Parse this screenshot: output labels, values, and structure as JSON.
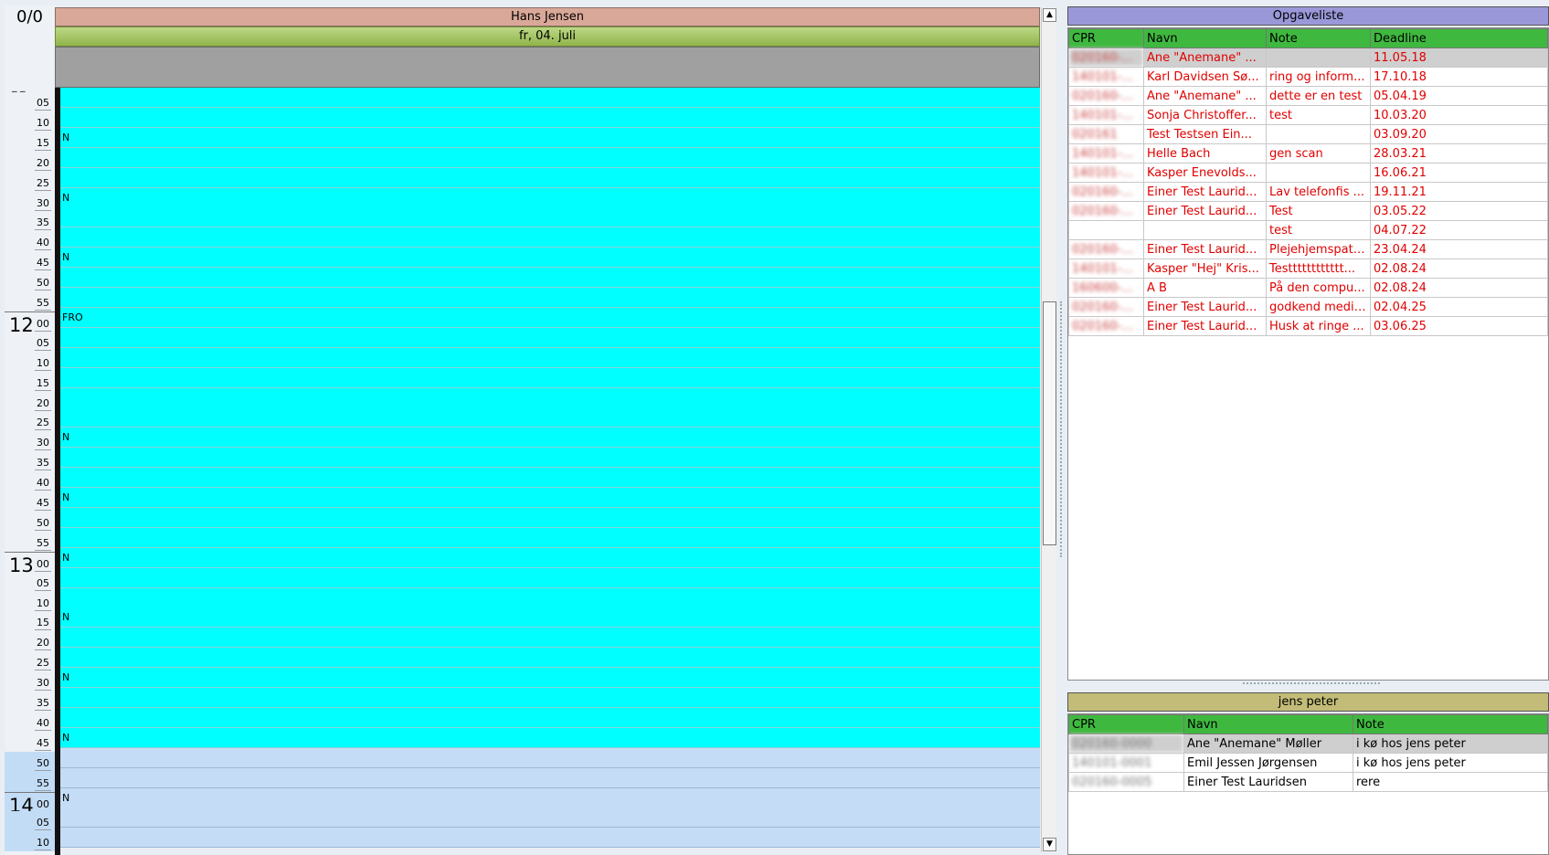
{
  "counter": "0/0",
  "calendar": {
    "person": "Hans Jensen",
    "date": "fr, 04. juli",
    "allday_dashes": "_ _",
    "ruler": [
      {
        "min": "05"
      },
      {
        "min": "10"
      },
      {
        "min": "15"
      },
      {
        "min": "20"
      },
      {
        "min": "25"
      },
      {
        "min": "30"
      },
      {
        "min": "35"
      },
      {
        "min": "40"
      },
      {
        "min": "45"
      },
      {
        "min": "50"
      },
      {
        "min": "55"
      },
      {
        "hour": "12",
        "min": "00"
      },
      {
        "min": "05"
      },
      {
        "min": "10"
      },
      {
        "min": "15"
      },
      {
        "min": "20"
      },
      {
        "min": "25"
      },
      {
        "min": "30"
      },
      {
        "min": "35"
      },
      {
        "min": "40"
      },
      {
        "min": "45"
      },
      {
        "min": "50"
      },
      {
        "min": "55"
      },
      {
        "hour": "13",
        "min": "00"
      },
      {
        "min": "05"
      },
      {
        "min": "10"
      },
      {
        "min": "15"
      },
      {
        "min": "20"
      },
      {
        "min": "25"
      },
      {
        "min": "30"
      },
      {
        "min": "35"
      },
      {
        "min": "40"
      },
      {
        "min": "45"
      },
      {
        "min": "50"
      },
      {
        "min": "55"
      },
      {
        "hour": "14",
        "min": "00"
      },
      {
        "min": "05"
      },
      {
        "min": "10"
      }
    ],
    "rows": [
      {
        "label": "",
        "free": false
      },
      {
        "label": "",
        "free": false
      },
      {
        "label": "N",
        "free": false
      },
      {
        "label": "",
        "free": false
      },
      {
        "label": "",
        "free": false
      },
      {
        "label": "N",
        "free": false
      },
      {
        "label": "",
        "free": false
      },
      {
        "label": "",
        "free": false
      },
      {
        "label": "N",
        "free": false
      },
      {
        "label": "",
        "free": false
      },
      {
        "label": "",
        "free": false
      },
      {
        "label": "FRO",
        "free": false
      },
      {
        "label": "",
        "free": false
      },
      {
        "label": "",
        "free": false
      },
      {
        "label": "",
        "free": false
      },
      {
        "label": "",
        "free": false
      },
      {
        "label": "",
        "free": false
      },
      {
        "label": "N",
        "free": false
      },
      {
        "label": "",
        "free": false
      },
      {
        "label": "",
        "free": false
      },
      {
        "label": "N",
        "free": false
      },
      {
        "label": "",
        "free": false
      },
      {
        "label": "",
        "free": false
      },
      {
        "label": "N",
        "free": false
      },
      {
        "label": "",
        "free": false
      },
      {
        "label": "",
        "free": false
      },
      {
        "label": "N",
        "free": false
      },
      {
        "label": "",
        "free": false
      },
      {
        "label": "",
        "free": false
      },
      {
        "label": "N",
        "free": false
      },
      {
        "label": "",
        "free": false
      },
      {
        "label": "",
        "free": false
      },
      {
        "label": "N",
        "free": false
      },
      {
        "label": "",
        "free": true
      },
      {
        "label": "",
        "free": true
      },
      {
        "label": "N",
        "free": true
      },
      {
        "label": "",
        "free": true
      },
      {
        "label": "",
        "free": true
      }
    ]
  },
  "tasks": {
    "title": "Opgaveliste",
    "columns": [
      "CPR",
      "Navn",
      "Note",
      "Deadline"
    ],
    "rows": [
      {
        "cpr": "020160-0000",
        "name": "Ane \"Anemane\" ...",
        "note": "",
        "deadline": "11.05.18",
        "selected": true
      },
      {
        "cpr": "140101-0000",
        "name": "Karl Davidsen Sø...",
        "note": "ring og inform...",
        "deadline": "17.10.18"
      },
      {
        "cpr": "020160-0000",
        "name": "Ane \"Anemane\" ...",
        "note": "dette er en test",
        "deadline": "05.04.19"
      },
      {
        "cpr": "140101-0000",
        "name": "Sonja Christoffer...",
        "note": "test",
        "deadline": "10.03.20"
      },
      {
        "cpr": "020161",
        "name": "Test Testsen Ein...",
        "note": "",
        "deadline": "03.09.20"
      },
      {
        "cpr": "140101-0000",
        "name": "Helle Bach",
        "note": "gen scan",
        "deadline": "28.03.21"
      },
      {
        "cpr": "140101-0000",
        "name": "Kasper Enevolds...",
        "note": "",
        "deadline": "16.06.21"
      },
      {
        "cpr": "020160-0000",
        "name": "Einer Test Laurid...",
        "note": "Lav telefonfis ...",
        "deadline": "19.11.21"
      },
      {
        "cpr": "020160-0000",
        "name": "Einer Test Laurid...",
        "note": "Test",
        "deadline": "03.05.22"
      },
      {
        "cpr": "",
        "name": "",
        "note": "test",
        "deadline": "04.07.22"
      },
      {
        "cpr": "020160-0000",
        "name": "Einer Test Laurid...",
        "note": "Plejehjemspati...",
        "deadline": "23.04.24"
      },
      {
        "cpr": "140101-0000",
        "name": "Kasper \"Hej\" Kris...",
        "note": "Testttttttttttt...",
        "deadline": "02.08.24"
      },
      {
        "cpr": "160600-0000",
        "name": "A B",
        "note": "På den compu...",
        "deadline": "02.08.24"
      },
      {
        "cpr": "020160-0000",
        "name": "Einer Test Laurid...",
        "note": "godkend medicin",
        "deadline": "02.04.25"
      },
      {
        "cpr": "020160-0000",
        "name": "Einer Test Laurid...",
        "note": "Husk at ringe ...",
        "deadline": "03.06.25"
      }
    ]
  },
  "queue": {
    "title": "jens peter",
    "columns": [
      "CPR",
      "Navn",
      "Note"
    ],
    "rows": [
      {
        "cpr": "020160-0000",
        "name": "Ane \"Anemane\" Møller",
        "note": "i kø hos jens peter",
        "selected": true
      },
      {
        "cpr": "140101-0001",
        "name": "Emil Jessen Jørgensen",
        "note": "i kø hos jens peter"
      },
      {
        "cpr": "020160-0005",
        "name": "Einer Test Lauridsen",
        "note": "rere"
      }
    ]
  },
  "icons": {
    "scroll_up": "scroll-up-arrow-icon",
    "scroll_down": "scroll-down-arrow-icon"
  }
}
